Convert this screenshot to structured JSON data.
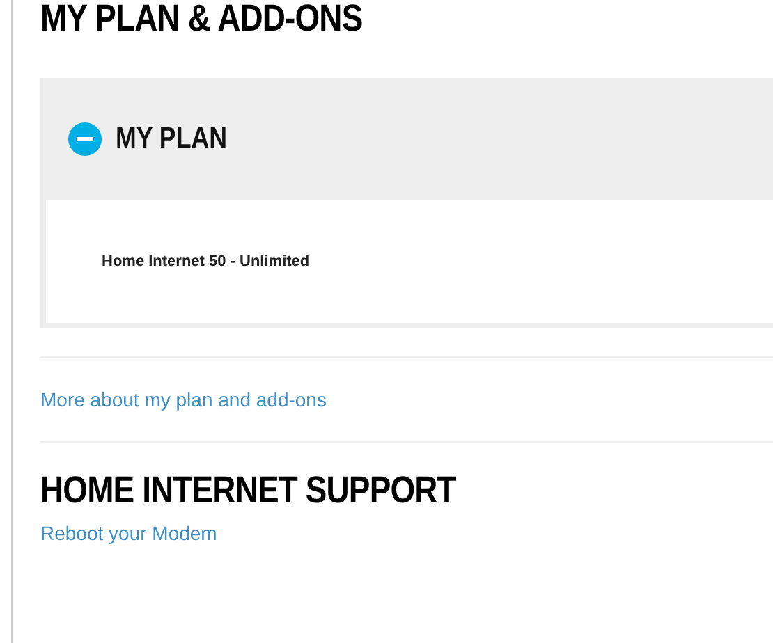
{
  "page_title": "MY PLAN & ADD-ONS",
  "plan_panel": {
    "title": "MY PLAN",
    "expanded": true,
    "items": [
      "Home Internet 50 - Unlimited"
    ]
  },
  "more_link": "More about my plan and add-ons",
  "support": {
    "title": "HOME INTERNET SUPPORT",
    "links": [
      "Reboot your Modem"
    ]
  }
}
